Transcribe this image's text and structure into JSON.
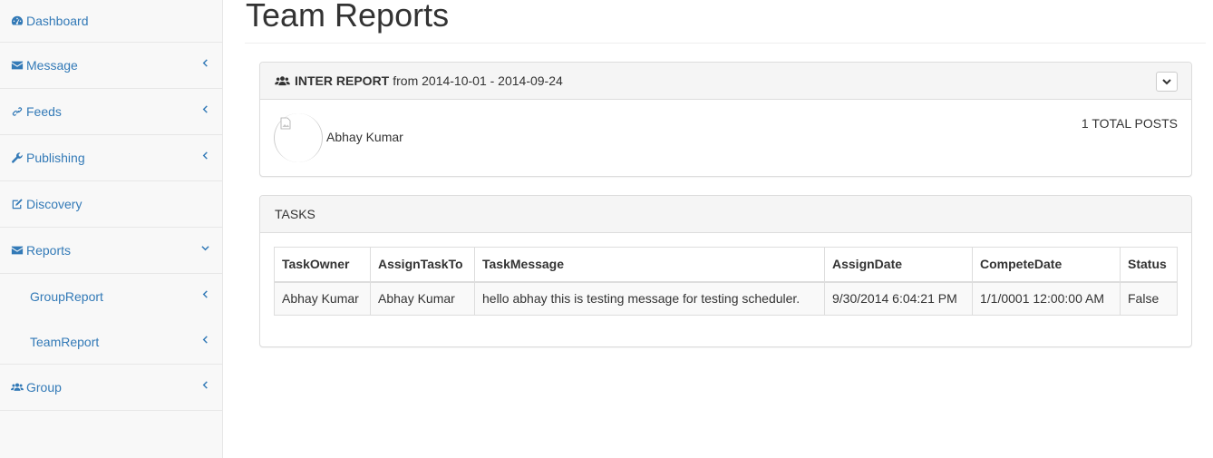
{
  "sidebar": {
    "items": [
      {
        "label": "Dashboard",
        "icon": "dashboard-icon"
      },
      {
        "label": "Message",
        "icon": "envelope-icon"
      },
      {
        "label": "Feeds",
        "icon": "link-icon"
      },
      {
        "label": "Publishing",
        "icon": "wrench-icon"
      },
      {
        "label": "Discovery",
        "icon": "edit-icon"
      },
      {
        "label": "Reports",
        "icon": "envelope-icon"
      },
      {
        "label": "GroupReport"
      },
      {
        "label": "TeamReport"
      },
      {
        "label": "Group",
        "icon": "users-icon"
      }
    ]
  },
  "page": {
    "title": "Team Reports"
  },
  "report": {
    "heading_bold": "INTER REPORT",
    "heading_range": "from 2014-10-01 - 2014-09-24",
    "member_name": "Abhay Kumar",
    "total_posts": "1 TOTAL POSTS"
  },
  "tasks": {
    "heading": "TASKS",
    "columns": [
      "TaskOwner",
      "AssignTaskTo",
      "TaskMessage",
      "AssignDate",
      "CompeteDate",
      "Status"
    ],
    "rows": [
      [
        "Abhay Kumar",
        "Abhay Kumar",
        "hello abhay this is testing message for testing scheduler.",
        "9/30/2014 6:04:21 PM",
        "1/1/0001 12:00:00 AM",
        "False"
      ]
    ]
  },
  "colors": {
    "link": "#337ab7",
    "sidebar_bg": "#f8f8f8",
    "panel_heading_bg": "#f5f5f5"
  }
}
